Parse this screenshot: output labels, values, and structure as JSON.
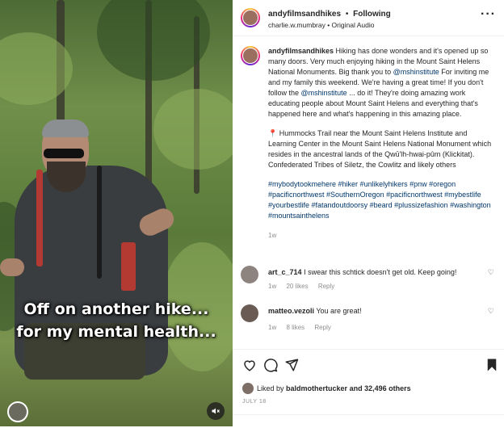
{
  "video": {
    "caption_line1": "Off on another hike...",
    "caption_line2": "for my mental health..."
  },
  "header": {
    "username": "andyfilmsandhikes",
    "separator": "•",
    "follow_status": "Following",
    "audio": "charlie.w.mumbray • Original Audio"
  },
  "post": {
    "username": "andyfilmsandhikes",
    "p1_a": "Hiking has done wonders and it's opened up so many doors. Very much enjoying hiking in the Mount Saint Helens National Monuments. Big thank you to ",
    "p1_mention": "@mshinstitute",
    "p1_b": " For inviting me and my family this weekend. We're having a great time! If you don't follow the ",
    "p1_mention2": "@mshinstitute",
    "p1_c": " ... do it! They're doing amazing work educating people about Mount Saint Helens and everything that's happened here and what's happening in this amazing place.",
    "p2": "📍 Hummocks Trail near the Mount Saint Helens Institute and Learning Center in the Mount Saint Helens National Monument which resides in the ancestral lands of the Qwū'lh-hwai-pûm (Klickitat). Confederated Tribes of Siletz, the Cowlitz and likely others",
    "hashtags": "#mybodytookmehere #hiker #unlikelyhikers #pnw #oregon #pacificnorthwest #SouthernOregon #pacificnorthwest #mybestlife #yourbestlife #fatandoutdoorsy #beard #plussizefashion #washington #mountsainthelens",
    "age": "1w"
  },
  "comments": [
    {
      "user": "art_c_714",
      "text": "I swear this schtick doesn't get old. Keep going!",
      "age": "1w",
      "likes": "20 likes",
      "reply": "Reply"
    },
    {
      "user": "matteo.vezoli",
      "text": "You are great!",
      "age": "1w",
      "likes": "8 likes",
      "reply": "Reply"
    }
  ],
  "footer": {
    "liked_prefix": "Liked by ",
    "liked_user": "baldmothertucker",
    "liked_suffix": " and 32,496 others",
    "date": "JULY 18"
  },
  "icons": [
    "heart-icon",
    "comment-icon",
    "share-icon",
    "bookmark-icon",
    "more-icon",
    "mute-icon"
  ]
}
